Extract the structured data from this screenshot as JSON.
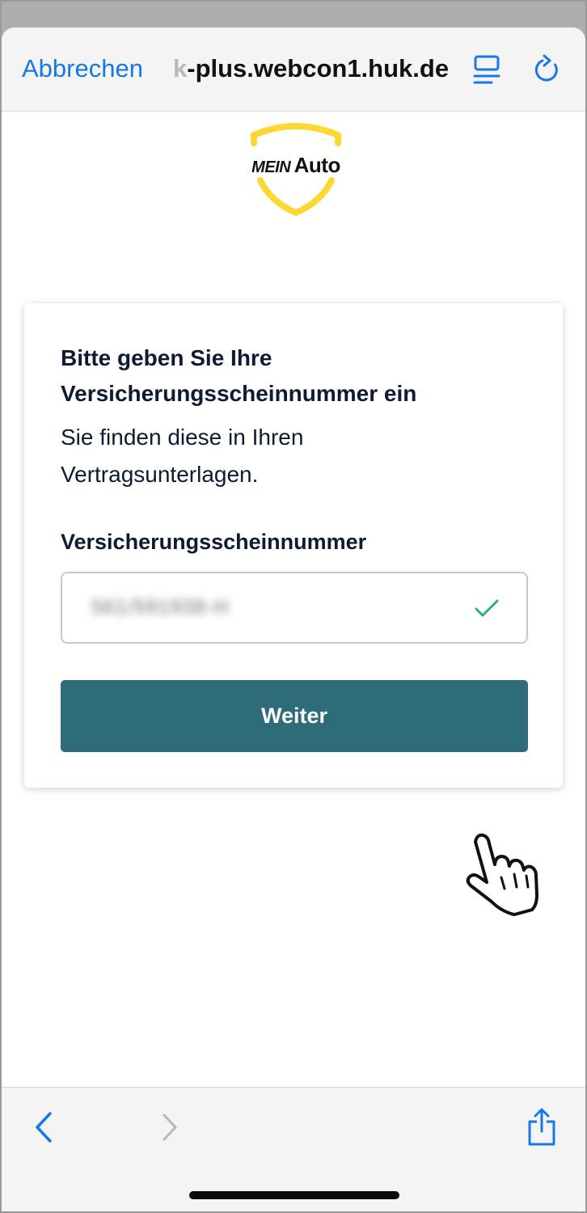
{
  "browser": {
    "cancel_label": "Abbrechen",
    "url_prefix": "k",
    "url_text": "-plus.webcon1.huk.de",
    "reader_icon": "reader-mode-icon",
    "reload_icon": "reload-icon"
  },
  "logo": {
    "word1": "MEIN",
    "word2": "Auto",
    "accent_color": "#FDD835"
  },
  "card": {
    "title": "Bitte geben Sie Ihre Versicherungsscheinnummer ein",
    "subtitle": "Sie finden diese in Ihren Vertragsunterlagen.",
    "field_label": "Versicherungsscheinnummer",
    "field_value": "561/591938-H",
    "field_valid": true,
    "submit_label": "Weiter",
    "button_color": "#2F6C79"
  },
  "toolbar": {
    "back_icon": "chevron-left-icon",
    "forward_icon": "chevron-right-icon",
    "share_icon": "share-icon"
  },
  "colors": {
    "link_blue": "#1778E6",
    "check_green": "#2FB36A",
    "text_dark": "#0D1B33"
  }
}
